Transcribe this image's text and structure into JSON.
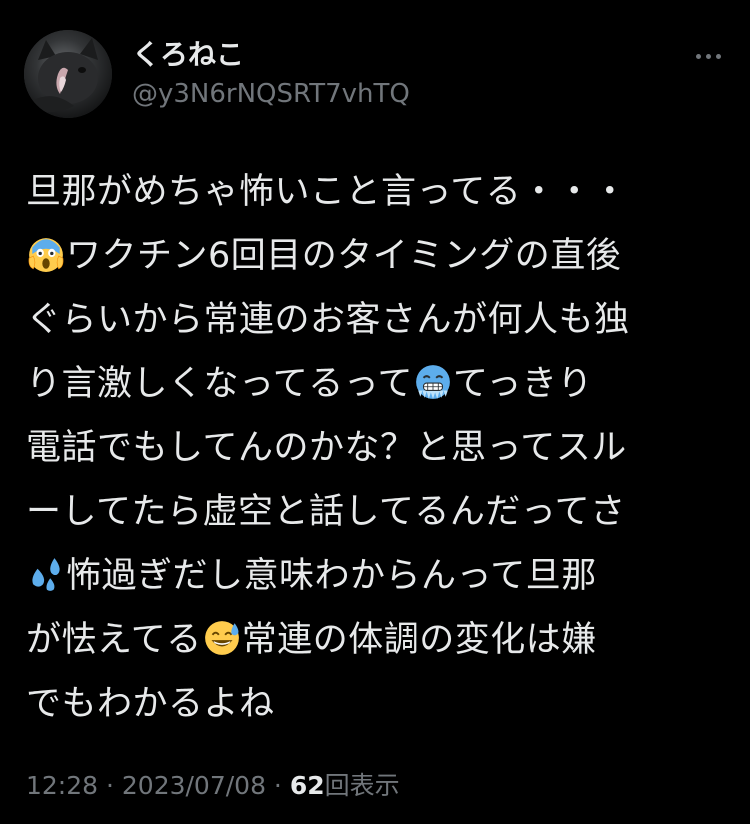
{
  "tweet": {
    "author": {
      "display_name": "くろねこ",
      "handle": "@y3N6rNQSRT7vhTQ",
      "avatar_icon": "black-cat-avatar-icon"
    },
    "more_icon": "more-horizontal-icon",
    "body_lines": [
      {
        "before": "旦那がめちゃ怖いこと言ってる・・・",
        "emoji": "",
        "after": ""
      },
      {
        "before": "",
        "emoji": "scream-emoji",
        "after": "ワクチン6回目のタイミングの直後"
      },
      {
        "before": "ぐらいから常連のお客さんが何人も独",
        "emoji": "",
        "after": ""
      },
      {
        "before": "り言激しくなってるって",
        "emoji": "cold-face-emoji",
        "after": "てっきり"
      },
      {
        "before": "電話でもしてんのかな？と思ってスル",
        "emoji": "",
        "after": ""
      },
      {
        "before": "ーしてたら虚空と話してるんだってさ",
        "emoji": "",
        "after": ""
      },
      {
        "before": "",
        "emoji": "sweat-droplets-emoji",
        "after": "怖過ぎだし意味わからんって旦那"
      },
      {
        "before": "が怯えてる",
        "emoji": "grinning-sweat-emoji",
        "after": "常連の体調の変化は嫌"
      },
      {
        "before": "でもわかるよね",
        "emoji": "",
        "after": ""
      }
    ],
    "meta": {
      "time": "12:28",
      "separator1": " · ",
      "date": "2023/07/08",
      "separator2": " · ",
      "views_count": "62",
      "views_label": "回表示"
    }
  },
  "colors": {
    "background": "#000000",
    "primary_text": "#e7e9ea",
    "secondary_text": "#71767b"
  }
}
